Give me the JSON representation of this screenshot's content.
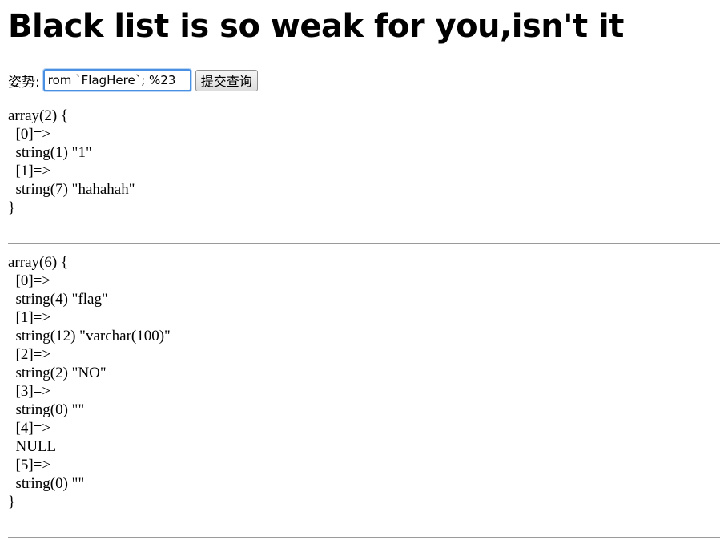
{
  "page": {
    "heading": "Black list is so weak for you,isn't it"
  },
  "form": {
    "label": "姿势:",
    "input_value": "rom `FlagHere`; %23",
    "submit_label": "提交查询"
  },
  "results": [
    {
      "lines": [
        "array(2) {",
        "  [0]=>",
        "  string(1) \"1\"",
        "  [1]=>",
        "  string(7) \"hahahah\"",
        "}"
      ]
    },
    {
      "lines": [
        "array(6) {",
        "  [0]=>",
        "  string(4) \"flag\"",
        "  [1]=>",
        "  string(12) \"varchar(100)\"",
        "  [2]=>",
        "  string(2) \"NO\"",
        "  [3]=>",
        "  string(0) \"\"",
        "  [4]=>",
        "  NULL",
        "  [5]=>",
        "  string(0) \"\"",
        "}"
      ]
    }
  ]
}
